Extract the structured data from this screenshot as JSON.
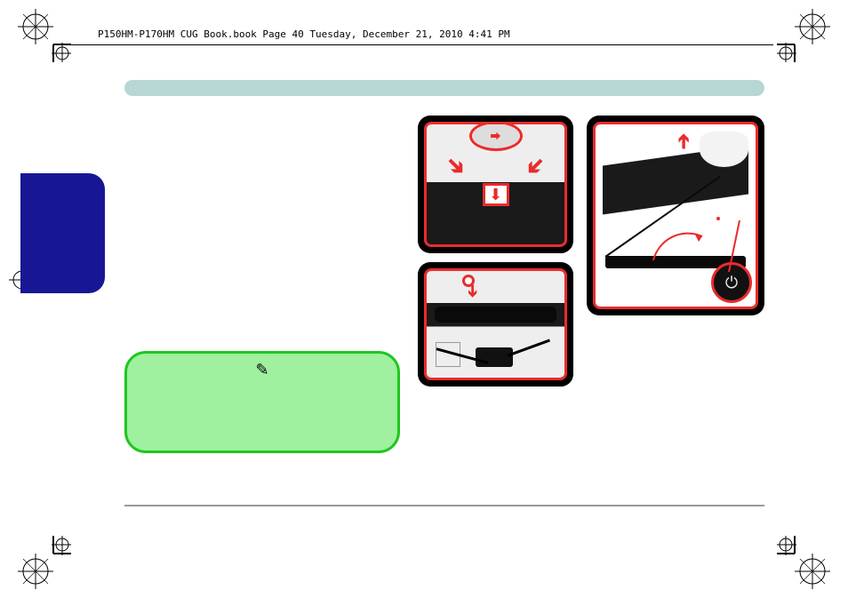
{
  "page": {
    "header": "P150HM-P170HM CUG Book.book  Page 40  Tuesday, December 21, 2010  4:41 PM"
  },
  "icons": {
    "pencil": "✎"
  },
  "frames": {
    "frame1_name": "battery-install-photo",
    "frame2_name": "adapter-connect-photo",
    "frame3_name": "open-lid-power-photo"
  }
}
